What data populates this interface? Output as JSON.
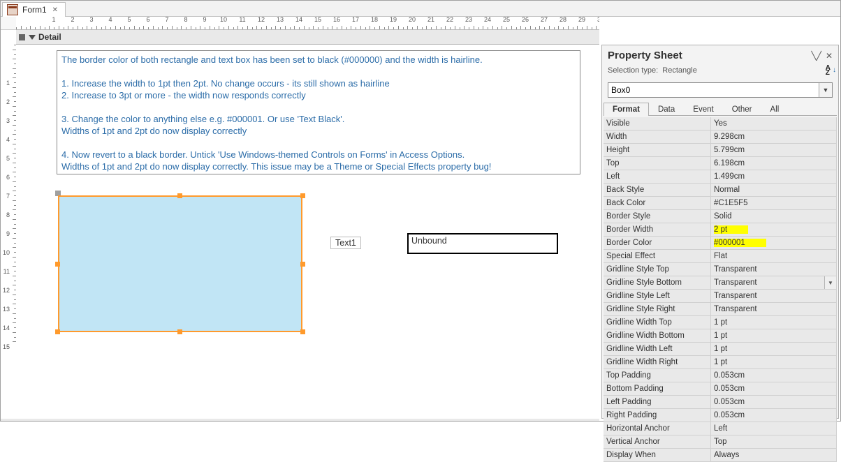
{
  "tab": {
    "title": "Form1"
  },
  "section_bar": {
    "label": "Detail"
  },
  "instructions": "The border color of both rectangle and text box has been set to black (#000000) and the width is hairline.\n\n1. Increase the width to 1pt then 2pt. No change occurs - its still shown as hairline\n2. Increase to 3pt or more - the width now responds correctly\n\n3. Change the color to anything else e.g. #000001. Or use 'Text Black'.\n    Widths of 1pt and 2pt do now display correctly\n\n4. Now revert to a black border. Untick 'Use Windows-themed Controls on Forms' in Access Options.\n    Widths of 1pt and 2pt do now display correctly. This issue may be a Theme or Special Effects property bug!",
  "design": {
    "text1_label": "Text1",
    "unbound": "Unbound"
  },
  "prop": {
    "title": "Property Sheet",
    "selection_prefix": "Selection type:",
    "selection_type": "Rectangle",
    "sort_label": "A Z",
    "combo_value": "Box0",
    "tabs": [
      "Format",
      "Data",
      "Event",
      "Other",
      "All"
    ],
    "rows": [
      {
        "name": "Visible",
        "value": "Yes"
      },
      {
        "name": "Width",
        "value": "9.298cm"
      },
      {
        "name": "Height",
        "value": "5.799cm"
      },
      {
        "name": "Top",
        "value": "6.198cm"
      },
      {
        "name": "Left",
        "value": "1.499cm"
      },
      {
        "name": "Back Style",
        "value": "Normal"
      },
      {
        "name": "Back Color",
        "value": "#C1E5F5"
      },
      {
        "name": "Border Style",
        "value": "Solid"
      },
      {
        "name": "Border Width",
        "value": "2 pt",
        "hl": true
      },
      {
        "name": "Border Color",
        "value": "#000001",
        "hl": true
      },
      {
        "name": "Special Effect",
        "value": "Flat"
      },
      {
        "name": "Gridline Style Top",
        "value": "Transparent"
      },
      {
        "name": "Gridline Style Bottom",
        "value": "Transparent",
        "dd": true
      },
      {
        "name": "Gridline Style Left",
        "value": "Transparent"
      },
      {
        "name": "Gridline Style Right",
        "value": "Transparent"
      },
      {
        "name": "Gridline Width Top",
        "value": "1 pt"
      },
      {
        "name": "Gridline Width Bottom",
        "value": "1 pt"
      },
      {
        "name": "Gridline Width Left",
        "value": "1 pt"
      },
      {
        "name": "Gridline Width Right",
        "value": "1 pt"
      },
      {
        "name": "Top Padding",
        "value": "0.053cm"
      },
      {
        "name": "Bottom Padding",
        "value": "0.053cm"
      },
      {
        "name": "Left Padding",
        "value": "0.053cm"
      },
      {
        "name": "Right Padding",
        "value": "0.053cm"
      },
      {
        "name": "Horizontal Anchor",
        "value": "Left"
      },
      {
        "name": "Vertical Anchor",
        "value": "Top"
      },
      {
        "name": "Display When",
        "value": "Always"
      }
    ]
  },
  "ruler": {
    "h_count": 31,
    "v_count": 15
  }
}
